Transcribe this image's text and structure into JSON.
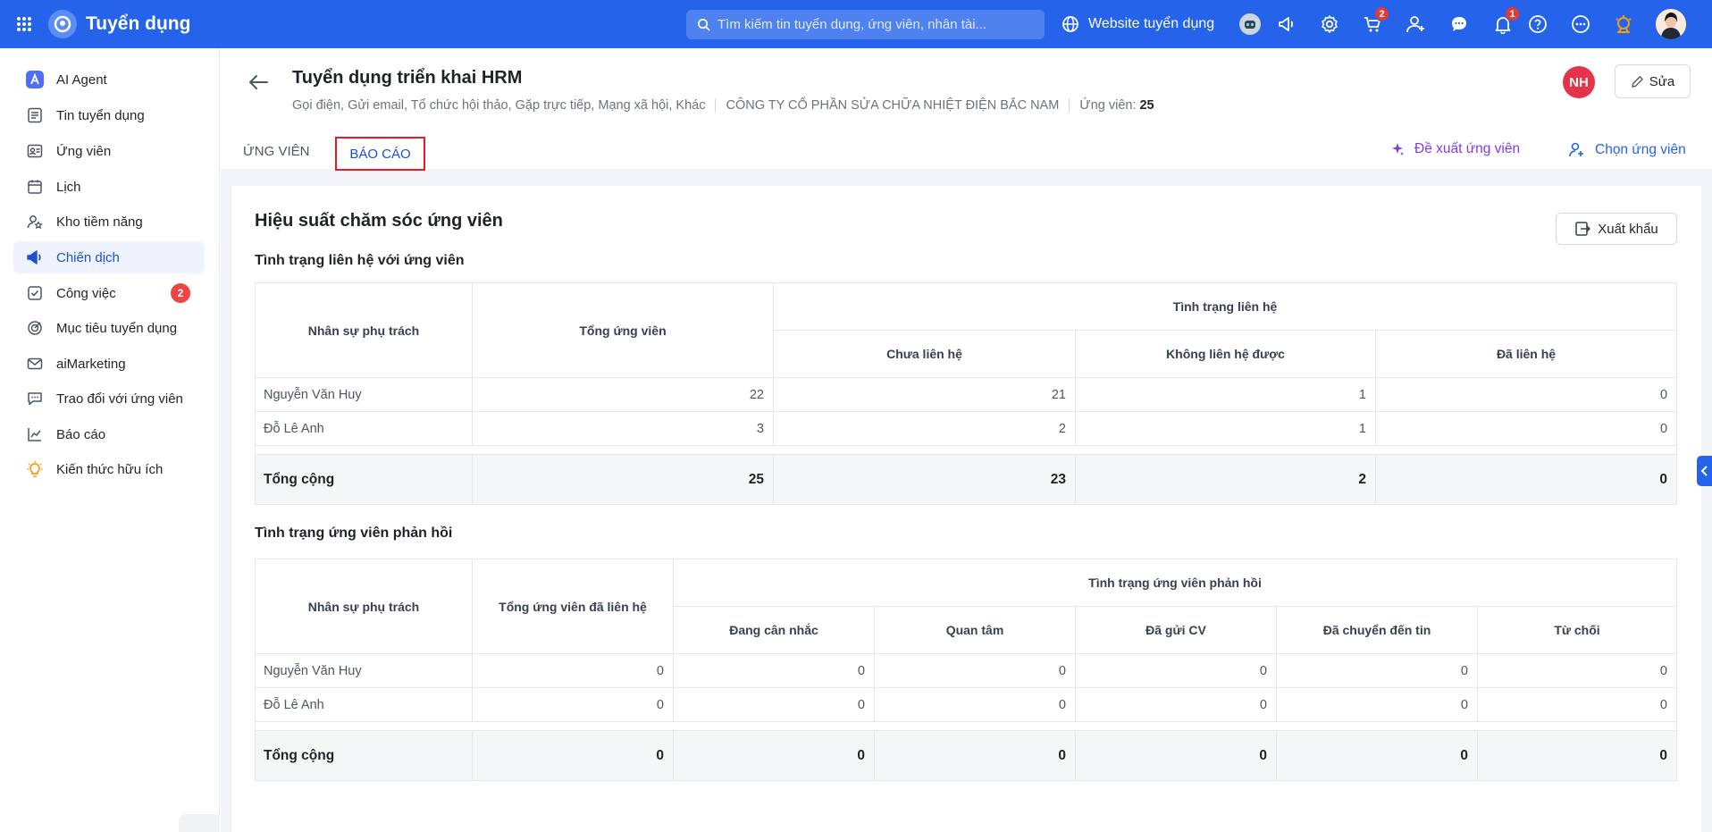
{
  "app": {
    "title": "Tuyển dụng"
  },
  "search": {
    "placeholder": "Tìm kiếm tin tuyển dụng, ứng viên, nhân tài..."
  },
  "topbar": {
    "website_label": "Website tuyển dụng",
    "cart_badge": "2",
    "notif_badge": "1"
  },
  "sidebar": {
    "items": [
      {
        "label": "AI Agent",
        "icon": "ai-agent-icon"
      },
      {
        "label": "Tin tuyển dụng",
        "icon": "job-post-icon"
      },
      {
        "label": "Ứng viên",
        "icon": "candidate-icon"
      },
      {
        "label": "Lịch",
        "icon": "calendar-icon"
      },
      {
        "label": "Kho tiềm năng",
        "icon": "talent-pool-icon"
      },
      {
        "label": "Chiến dịch",
        "icon": "campaign-icon",
        "active": true
      },
      {
        "label": "Công việc",
        "icon": "task-icon",
        "badge": "2"
      },
      {
        "label": "Mục tiêu tuyển dụng",
        "icon": "target-icon"
      },
      {
        "label": "aiMarketing",
        "icon": "mail-icon"
      },
      {
        "label": "Trao đổi với ứng viên",
        "icon": "chat-icon"
      },
      {
        "label": "Báo cáo",
        "icon": "report-icon"
      },
      {
        "label": "Kiến thức hữu ích",
        "icon": "lightbulb-icon"
      }
    ]
  },
  "header": {
    "title": "Tuyển dụng triển khai HRM",
    "channels": "Gọi điện, Gửi email, Tổ chức hội thảo, Gặp trực tiếp, Mạng xã hội, Khác",
    "company": "CÔNG TY CỔ PHẦN SỬA CHỮA NHIỆT ĐIỆN BẮC NAM",
    "candidates_label": "Ứng viên:",
    "candidates_count": "25",
    "avatar_initials": "NH",
    "edit_label": "Sửa"
  },
  "tabs": {
    "candidates": "ỨNG VIÊN",
    "report": "BÁO CÁO"
  },
  "actions": {
    "suggest": "Đề xuất ứng viên",
    "choose": "Chọn ứng viên"
  },
  "report": {
    "title": "Hiệu suất chăm sóc ứng viên",
    "export_label": "Xuất khẩu",
    "contact": {
      "section_title": "Tình trạng liên hệ với ứng viên",
      "headers": {
        "owner": "Nhân sự phụ trách",
        "total": "Tổng ứng viên",
        "group": "Tình trạng liên hệ",
        "not_contacted": "Chưa liên hệ",
        "unreachable": "Không liên hệ được",
        "contacted": "Đã liên hệ"
      },
      "rows": [
        {
          "name": "Nguyễn Văn Huy",
          "total": "22",
          "not_contacted": "21",
          "unreachable": "1",
          "contacted": "0"
        },
        {
          "name": "Đỗ Lê Anh",
          "total": "3",
          "not_contacted": "2",
          "unreachable": "1",
          "contacted": "0"
        }
      ],
      "totals": {
        "label": "Tổng cộng",
        "total": "25",
        "not_contacted": "23",
        "unreachable": "2",
        "contacted": "0"
      }
    },
    "response": {
      "section_title": "Tình trạng ứng viên phản hồi",
      "headers": {
        "owner": "Nhân sự phụ trách",
        "total": "Tổng ứng viên đã liên hệ",
        "group": "Tình trạng ứng viên phản hồi",
        "considering": "Đang cân nhắc",
        "interested": "Quan tâm",
        "cv_sent": "Đã gửi CV",
        "moved": "Đã chuyển đến tin",
        "rejected": "Từ chối"
      },
      "rows": [
        {
          "name": "Nguyễn Văn Huy",
          "total": "0",
          "considering": "0",
          "interested": "0",
          "cv_sent": "0",
          "moved": "0",
          "rejected": "0"
        },
        {
          "name": "Đỗ Lê Anh",
          "total": "0",
          "considering": "0",
          "interested": "0",
          "cv_sent": "0",
          "moved": "0",
          "rejected": "0"
        }
      ],
      "totals": {
        "label": "Tổng cộng",
        "total": "0",
        "considering": "0",
        "interested": "0",
        "cv_sent": "0",
        "moved": "0",
        "rejected": "0"
      }
    }
  }
}
